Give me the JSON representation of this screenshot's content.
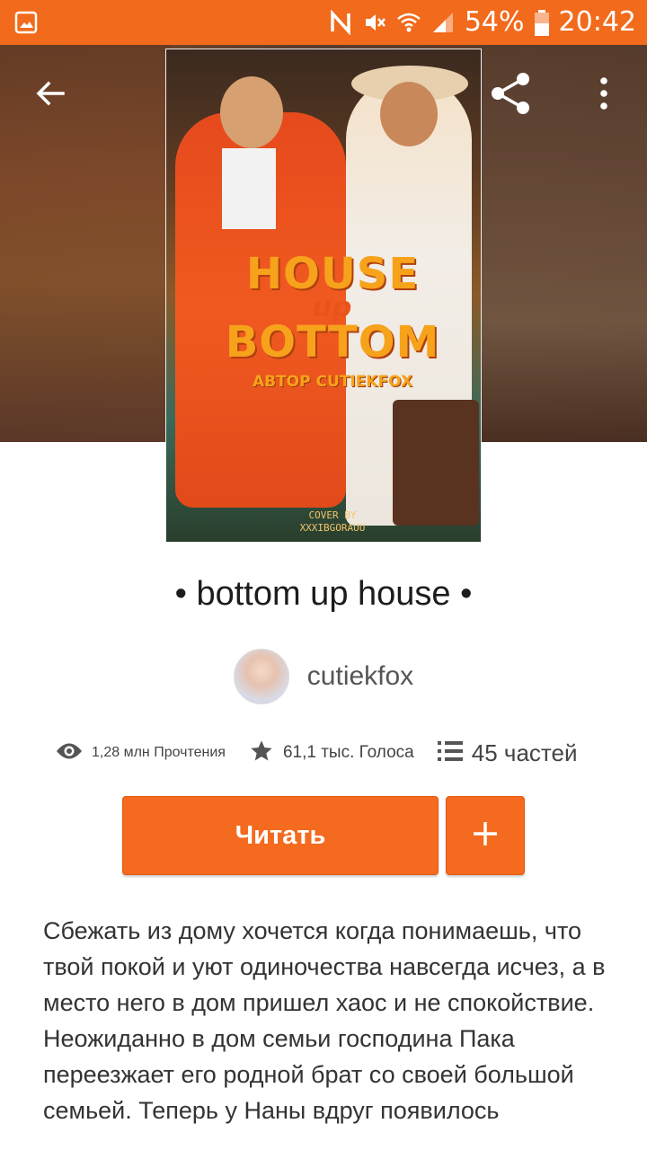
{
  "status_bar": {
    "battery": "54%",
    "time": "20:42",
    "icons": [
      "gallery-icon",
      "nfc-icon",
      "mute-icon",
      "wifi-icon",
      "signal-icon",
      "battery-icon"
    ]
  },
  "toolbar": {
    "icons": [
      "back-arrow-icon",
      "share-icon",
      "more-vertical-icon"
    ]
  },
  "cover": {
    "title_line1": "HOUSE",
    "title_line2": "up",
    "title_line3": "BOTTOM",
    "author_line": "АВТОР CUTIEKFOX",
    "credit_line1": "COVER BY",
    "credit_line2": "XXXIBGORAUU"
  },
  "story": {
    "title": "• bottom up house •",
    "author": "cutiekfox"
  },
  "stats": {
    "reads": "1,28 млн Прочтения",
    "votes": "61,1 тыс. Голоса",
    "parts": "45 частей"
  },
  "actions": {
    "read_label": "Читать",
    "add_icon": "plus-icon"
  },
  "description": {
    "paragraph1": "Сбежать из дому хочется когда понимаешь, что твой покой и уют одиночества навсегда исчез, а в место него в дом пришел хаос и не спокойствие.",
    "paragraph2": "Неожиданно в дом семьи господина Пака переезжает его родной брат со своей большой семьей. Теперь у Наны вдруг появилось"
  },
  "colors": {
    "accent": "#f26a1b",
    "button": "#f46a1e"
  }
}
